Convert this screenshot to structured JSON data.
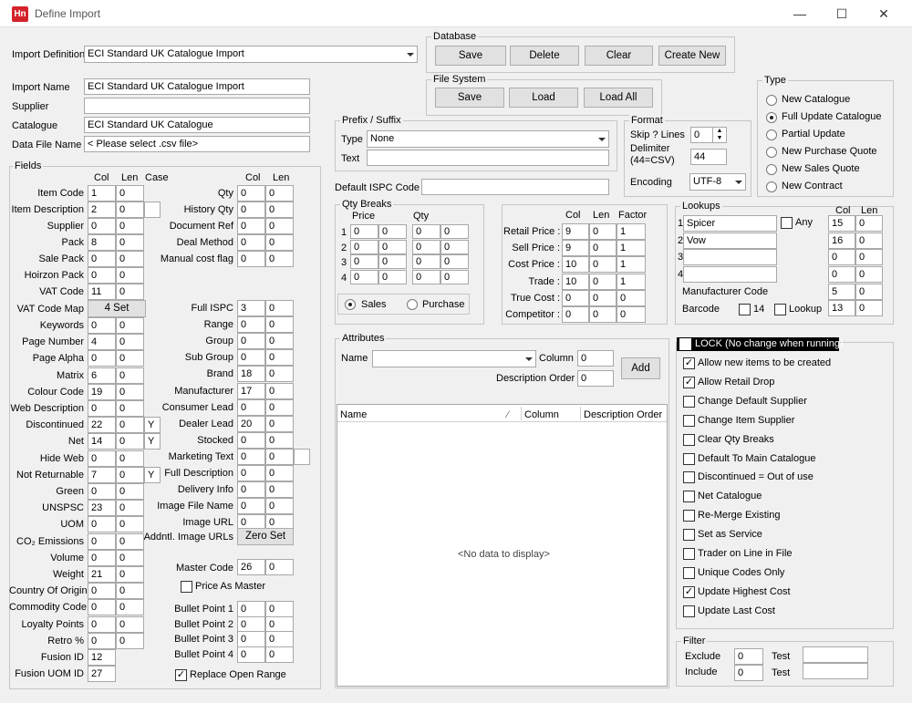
{
  "window": {
    "title": "Define Import",
    "app_icon_text": "Hn",
    "minimize": "—",
    "maximize": "☐",
    "close": "✕"
  },
  "import_definition": {
    "label": "Import Definition",
    "value": "ECI Standard UK Catalogue Import"
  },
  "database": {
    "title": "Database",
    "save": "Save",
    "delete": "Delete",
    "clear": "Clear",
    "create_new": "Create New"
  },
  "file_system": {
    "title": "File System",
    "save": "Save",
    "load": "Load",
    "load_all": "Load All"
  },
  "type_group": {
    "title": "Type",
    "options": [
      "New Catalogue",
      "Full Update Catalogue",
      "Partial Update",
      "New Purchase Quote",
      "New Sales Quote",
      "New Contract"
    ],
    "selected_index": 1
  },
  "details": {
    "import_name_label": "Import Name",
    "import_name": "ECI Standard UK Catalogue Import",
    "supplier_label": "Supplier",
    "supplier": "",
    "catalogue_label": "Catalogue",
    "catalogue": "ECI Standard UK Catalogue",
    "data_file_label": "Data File Name",
    "data_file": "< Please select .csv file>"
  },
  "prefix_suffix": {
    "title": "Prefix / Suffix",
    "type_label": "Type",
    "type_value": "None",
    "text_label": "Text",
    "text_value": ""
  },
  "format": {
    "title": "Format",
    "skip_label": "Skip ? Lines",
    "skip_value": "0",
    "delimiter_label_1": "Delimiter",
    "delimiter_label_2": "(44=CSV)",
    "delimiter_value": "44",
    "encoding_label": "Encoding",
    "encoding_value": "UTF-8"
  },
  "default_ispc": {
    "label": "Default ISPC Code",
    "value": ""
  },
  "fields": {
    "title": "Fields",
    "headers": {
      "col": "Col",
      "len": "Len",
      "case": "Case",
      "col2": "Col",
      "len2": "Len"
    },
    "left": [
      {
        "label": "Item Code",
        "col": "1",
        "len": "0"
      },
      {
        "label": "Item Description",
        "col": "2",
        "len": "0",
        "case": ""
      },
      {
        "label": "Supplier",
        "col": "0",
        "len": "0"
      },
      {
        "label": "Pack",
        "col": "8",
        "len": "0"
      },
      {
        "label": "Sale Pack",
        "col": "0",
        "len": "0"
      },
      {
        "label": "Hoirzon Pack",
        "col": "0",
        "len": "0"
      },
      {
        "label": "VAT Code",
        "col": "11",
        "len": "0"
      }
    ],
    "vat_map": {
      "label": "VAT Code Map",
      "button": "4 Set"
    },
    "left2": [
      {
        "label": "Keywords",
        "col": "0",
        "len": "0"
      },
      {
        "label": "Page Number",
        "col": "4",
        "len": "0"
      },
      {
        "label": "Page Alpha",
        "col": "0",
        "len": "0"
      },
      {
        "label": "Matrix",
        "col": "6",
        "len": "0"
      },
      {
        "label": "Colour Code",
        "col": "19",
        "len": "0"
      },
      {
        "label": "Web Description",
        "col": "0",
        "len": "0"
      },
      {
        "label": "Discontinued",
        "col": "22",
        "len": "0",
        "case": "Y"
      },
      {
        "label": "Net",
        "col": "14",
        "len": "0",
        "case": "Y"
      },
      {
        "label": "Hide Web",
        "col": "0",
        "len": "0"
      },
      {
        "label": "Not Returnable",
        "col": "7",
        "len": "0",
        "case": "Y"
      },
      {
        "label": "Green",
        "col": "0",
        "len": "0"
      },
      {
        "label": "UNSPSC",
        "col": "23",
        "len": "0"
      },
      {
        "label": "UOM",
        "col": "0",
        "len": "0"
      },
      {
        "label": "CO₂ Emissions",
        "col": "0",
        "len": "0"
      },
      {
        "label": "Volume",
        "col": "0",
        "len": "0"
      },
      {
        "label": "Weight",
        "col": "21",
        "len": "0"
      },
      {
        "label": "Country Of Origin",
        "col": "0",
        "len": "0"
      },
      {
        "label": "Commodity Code",
        "col": "0",
        "len": "0"
      },
      {
        "label": "Loyalty Points",
        "col": "0",
        "len": "0"
      },
      {
        "label": "Retro %",
        "col": "0",
        "len": "0"
      },
      {
        "label": "Fusion ID",
        "col": "12"
      },
      {
        "label": "Fusion UOM ID",
        "col": "27"
      }
    ],
    "right": [
      {
        "label": "Qty",
        "col": "0",
        "len": "0"
      },
      {
        "label": "History Qty",
        "col": "0",
        "len": "0"
      },
      {
        "label": "Document Ref",
        "col": "0",
        "len": "0"
      },
      {
        "label": "Deal Method",
        "col": "0",
        "len": "0"
      },
      {
        "label": "Manual cost flag",
        "col": "0",
        "len": "0"
      }
    ],
    "right2": [
      {
        "label": "Full ISPC",
        "col": "3",
        "len": "0"
      },
      {
        "label": "Range",
        "col": "0",
        "len": "0"
      },
      {
        "label": "Group",
        "col": "0",
        "len": "0"
      },
      {
        "label": "Sub Group",
        "col": "0",
        "len": "0"
      },
      {
        "label": "Brand",
        "col": "18",
        "len": "0"
      },
      {
        "label": "Manufacturer",
        "col": "17",
        "len": "0"
      },
      {
        "label": "Consumer Lead",
        "col": "0",
        "len": "0"
      },
      {
        "label": "Dealer Lead",
        "col": "20",
        "len": "0"
      },
      {
        "label": "Stocked",
        "col": "0",
        "len": "0"
      },
      {
        "label": "Marketing Text",
        "col": "0",
        "len": "0",
        "extra": ""
      },
      {
        "label": "Full  Description",
        "col": "0",
        "len": "0"
      },
      {
        "label": "Delivery Info",
        "col": "0",
        "len": "0"
      },
      {
        "label": "Image File Name",
        "col": "0",
        "len": "0"
      },
      {
        "label": "Image URL",
        "col": "0",
        "len": "0"
      }
    ],
    "addntl_image": {
      "label": "Addntl. Image URLs",
      "button": "Zero Set"
    },
    "master_code": {
      "label": "Master Code",
      "col": "26",
      "len": "0"
    },
    "price_as_master": {
      "label": "Price As Master",
      "checked": false
    },
    "bullets": [
      {
        "label": "Bullet Point 1",
        "col": "0",
        "len": "0"
      },
      {
        "label": "Bullet Point 2",
        "col": "0",
        "len": "0"
      },
      {
        "label": "Bullet Point 3",
        "col": "0",
        "len": "0"
      },
      {
        "label": "Bullet Point 4",
        "col": "0",
        "len": "0"
      }
    ],
    "replace_open_range": {
      "label": "Replace Open Range",
      "checked": true,
      "mark": "✓"
    }
  },
  "qty_breaks": {
    "title": "Qty Breaks",
    "price_label": "Price",
    "qty_label": "Qty",
    "rows": [
      {
        "n": "1",
        "p1": "0",
        "p2": "0",
        "q1": "0",
        "q2": "0"
      },
      {
        "n": "2",
        "p1": "0",
        "p2": "0",
        "q1": "0",
        "q2": "0"
      },
      {
        "n": "3",
        "p1": "0",
        "p2": "0",
        "q1": "0",
        "q2": "0"
      },
      {
        "n": "4",
        "p1": "0",
        "p2": "0",
        "q1": "0",
        "q2": "0"
      }
    ],
    "sales_label": "Sales",
    "purchase_label": "Purchase",
    "selected": "sales"
  },
  "prices": {
    "headers": {
      "col": "Col",
      "len": "Len",
      "factor": "Factor"
    },
    "rows": [
      {
        "label": "Retail Price :",
        "col": "9",
        "len": "0",
        "factor": "1"
      },
      {
        "label": "Sell Price :",
        "col": "9",
        "len": "0",
        "factor": "1"
      },
      {
        "label": "Cost Price :",
        "col": "10",
        "len": "0",
        "factor": "1"
      },
      {
        "label": "Trade :",
        "col": "10",
        "len": "0",
        "factor": "1"
      },
      {
        "label": "True Cost :",
        "col": "0",
        "len": "0",
        "factor": "0"
      },
      {
        "label": "Competitor :",
        "col": "0",
        "len": "0",
        "factor": "0"
      }
    ]
  },
  "lookups": {
    "title": "Lookups",
    "col_label": "Col",
    "len_label": "Len",
    "rows": [
      {
        "n": "1",
        "name": "Spicer",
        "col": "15",
        "len": "0"
      },
      {
        "n": "2",
        "name": "Vow",
        "col": "16",
        "len": "0"
      },
      {
        "n": "3",
        "name": "",
        "col": "0",
        "len": "0"
      },
      {
        "n": "4",
        "name": "",
        "col": "0",
        "len": "0"
      }
    ],
    "any_label": "Any",
    "manufacturer_code": {
      "label": "Manufacturer Code",
      "col": "5",
      "len": "0"
    },
    "barcode": {
      "label": "Barcode",
      "opt14": "14",
      "lookup": "Lookup",
      "col": "13",
      "len": "0"
    }
  },
  "attributes": {
    "title": "Attributes",
    "name_label": "Name",
    "name_value": "",
    "column_label": "Column",
    "column_value": "0",
    "desc_order_label": "Description Order",
    "desc_order_value": "0",
    "add": "Add",
    "grid_headers": [
      "Name",
      "Column",
      "Description Order"
    ],
    "sort_mark": "⁄",
    "empty": "<No data to display>"
  },
  "options": {
    "lock_label": "LOCK (No change when running)",
    "items": [
      {
        "label": "Allow new items to be created",
        "checked": true
      },
      {
        "label": "Allow Retail Drop",
        "checked": true
      },
      {
        "label": "Change Default Supplier",
        "checked": false
      },
      {
        "label": "Change Item Supplier",
        "checked": false
      },
      {
        "label": "Clear Qty Breaks",
        "checked": false
      },
      {
        "label": "Default To Main Catalogue",
        "checked": false
      },
      {
        "label": "Discontinued = Out of use",
        "checked": false
      },
      {
        "label": "Net Catalogue",
        "checked": false
      },
      {
        "label": "Re-Merge Existing",
        "checked": false
      },
      {
        "label": "Set as Service",
        "checked": false
      },
      {
        "label": "Trader on Line in File",
        "checked": false
      },
      {
        "label": "Unique Codes Only",
        "checked": false
      },
      {
        "label": "Update Highest Cost",
        "checked": true
      },
      {
        "label": "Update Last Cost",
        "checked": false
      }
    ],
    "check_mark": "✓"
  },
  "filter": {
    "title": "Filter",
    "exclude_label": "Exclude",
    "exclude_value": "0",
    "include_label": "Include",
    "include_value": "0",
    "test_label": "Test",
    "test1": "",
    "test2": ""
  }
}
